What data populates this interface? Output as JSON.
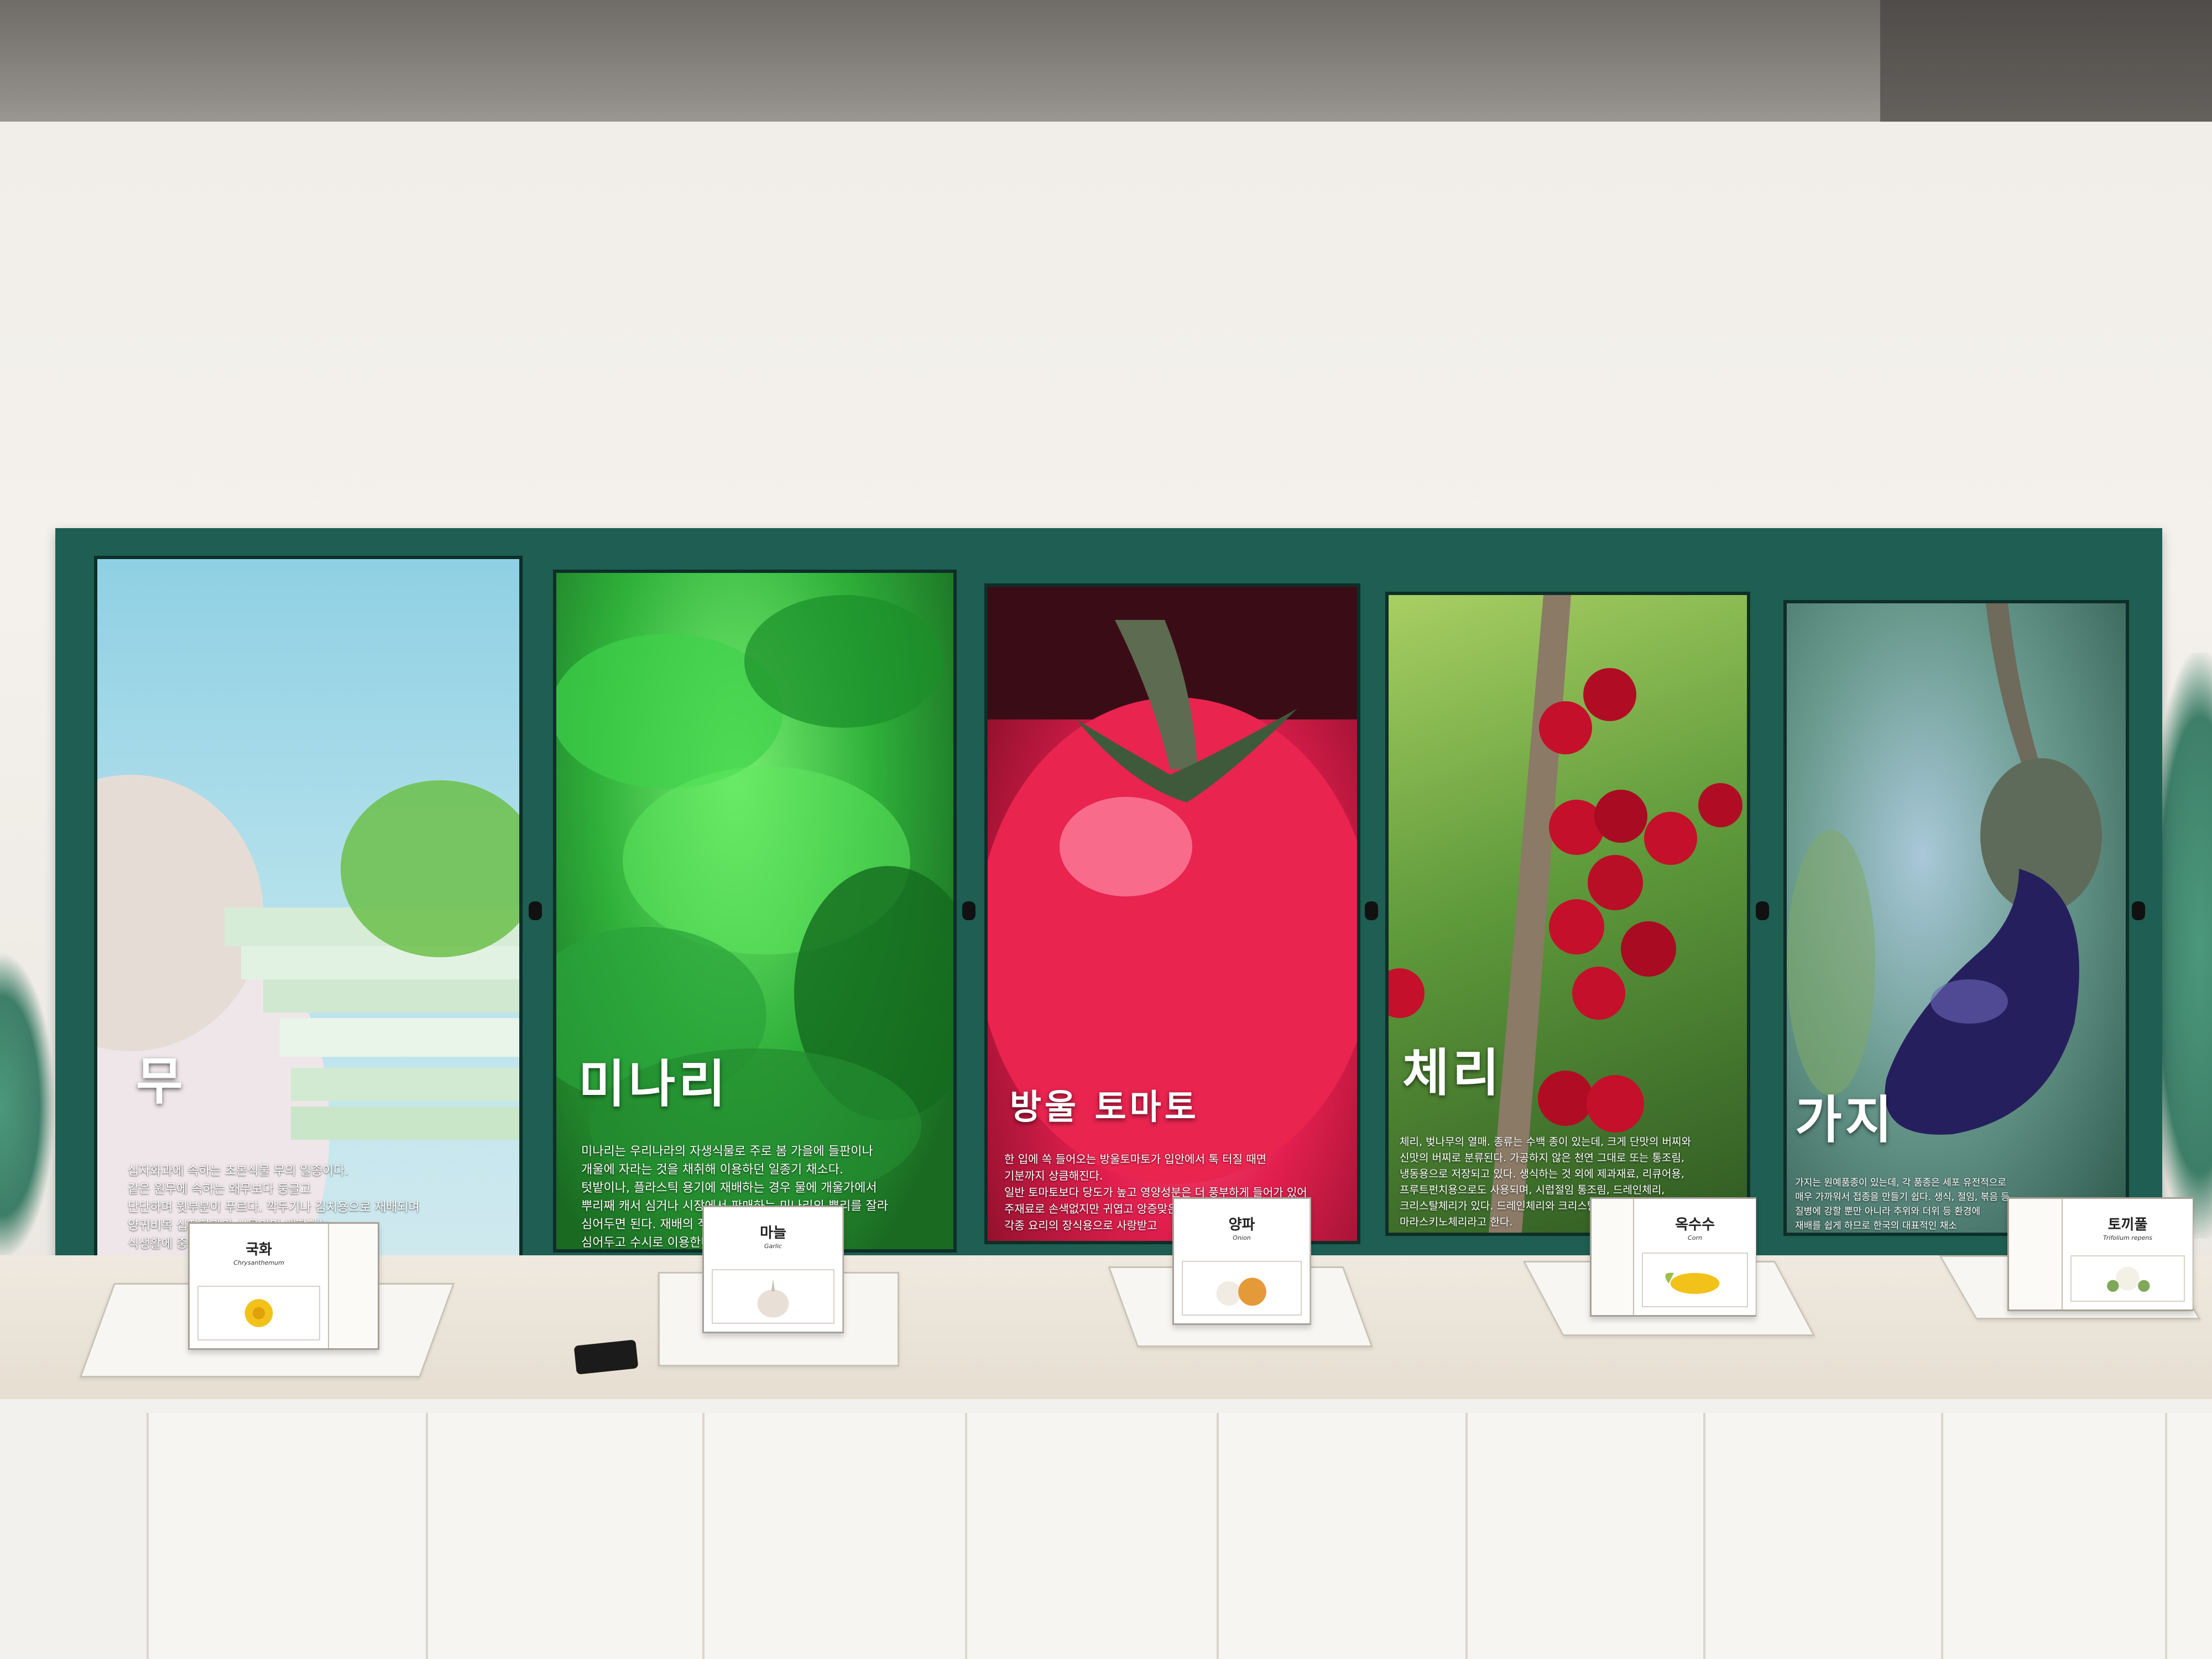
{
  "screens": [
    {
      "title": "무",
      "description": [
        "십자화과에 속하는 초본식물 무의 일종이다.",
        "같은 원무에 속하는 왜무보다 둥글고",
        "단단하며 윗부분이 푸르다. 깍두기나 김치용으로 재배되며",
        "양귀비목 십자화과의 식물이며 배향하는",
        "식생활에 중요한 채소"
      ]
    },
    {
      "title": "미나리",
      "description": [
        "미나리는 우리나라의 자생식물로 주로 봄 가을에 들판이나",
        "개울에 자라는 것을 채취해 이용하던 일종기 채소다.",
        "텃밭이나, 플라스틱 용기에 재배하는 경우 물에 개울가에서",
        "뿌리째 캐서 심거나 시장에서 판매하는 미나리의 뿌리를 잘라",
        "심어두면 된다. 재배의 적기가 있는 것이 아니기",
        "심어두고 수시로 이용한다."
      ]
    },
    {
      "title": "방울 토마토",
      "description": [
        "한 입에 쏙 들어오는 방울토마토가 입안에서 톡 터질 때면",
        "기분까지 상큼해진다.",
        "일반 토마토보다 당도가 높고 영양성분은 더 풍부하게 들어가 있어",
        "주재료로 손색없지만 귀엽고 앙증맞은 모습으로",
        "각종 요리의 장식용으로 사랑받고"
      ]
    },
    {
      "title": "체리",
      "description": [
        "체리, 벚나무의 열매. 종류는 수백 종이 있는데, 크게 단맛의 버찌와",
        "신맛의 버찌로 분류된다. 가공하지 않은 천연 그대로 또는 통조림,",
        "냉동용으로 저장되고 있다. 생식하는 것 외에 제과재료, 리큐어용,",
        "프루트펀치용으로도 사용되며, 시럽절임 통조림, 드레인체리,",
        "크리스탈체리가 있다. 드레인체리와 크리스탈체리를",
        "마라스키노체리라고 한다."
      ]
    },
    {
      "title": "가지",
      "description": [
        "가지는 원예품종이 있는데, 각 품종은 세포 유전적으로",
        "매우 가까워서 접종을 만들기 쉽다. 생식, 절임, 볶음 등",
        "질병에 강할 뿐만 아니라 추위와 더위 등 환경에",
        "재배를 쉽게 하므로 한국의 대표적인 채소"
      ]
    }
  ],
  "boxes": [
    {
      "title": "국화",
      "subtitle": "Chrysanthemum"
    },
    {
      "title": "마늘",
      "subtitle": "Garlic"
    },
    {
      "title": "양파",
      "subtitle": "Onion"
    },
    {
      "title": "옥수수",
      "subtitle": "Corn"
    },
    {
      "title": "토끼풀",
      "subtitle": "Trifolium repens"
    }
  ],
  "colors": {
    "frame": "#1f5e52",
    "wall": "#f1eee9",
    "counter": "#efe9df"
  }
}
